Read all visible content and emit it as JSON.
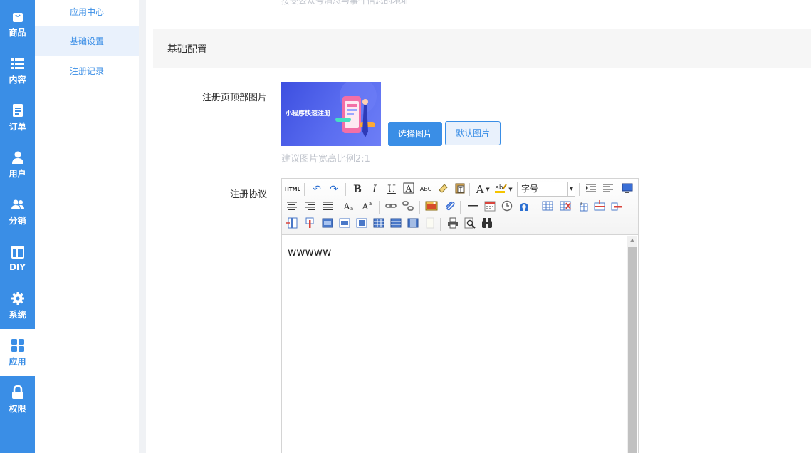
{
  "nav": {
    "items": [
      {
        "label": "商品",
        "icon": "bag-icon"
      },
      {
        "label": "内容",
        "icon": "list-icon"
      },
      {
        "label": "订单",
        "icon": "document-icon"
      },
      {
        "label": "用户",
        "icon": "user-icon"
      },
      {
        "label": "分销",
        "icon": "users-icon"
      },
      {
        "label": "DIY",
        "icon": "layout-icon"
      },
      {
        "label": "系统",
        "icon": "gear-icon"
      },
      {
        "label": "应用",
        "icon": "grid-icon"
      },
      {
        "label": "权限",
        "icon": "lock-icon"
      }
    ],
    "active": "应用"
  },
  "subnav": {
    "items": [
      "应用中心",
      "基础设置",
      "注册记录"
    ],
    "active": "基础设置"
  },
  "main": {
    "top_hint": "接受公众号消息与事件信息的地址",
    "section_title": "基础配置",
    "header_image_label": "注册页顶部图片",
    "banner_text": "小程序快速注册",
    "select_image_label": "选择图片",
    "default_image_label": "默认图片",
    "image_hint": "建议图片宽高比例2:1",
    "agreement_label": "注册协议",
    "editor": {
      "font_size_value": "字号",
      "content": "wwwww",
      "toolbar_text": {
        "html": "HTML",
        "bold": "B",
        "italic": "I",
        "underline": "U",
        "strike": "ABC",
        "font_color": "A",
        "special_char": "Ω"
      }
    }
  },
  "colors": {
    "primary": "#3a8ee6",
    "sidebar_bg": "#3a8ee6",
    "active_sub_bg": "#e9f1fc"
  }
}
